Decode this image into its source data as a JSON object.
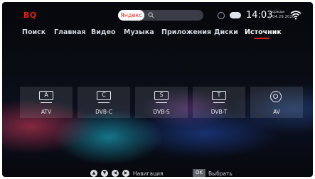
{
  "header": {
    "logo": "BQ",
    "search": {
      "brand": "Яндекс"
    },
    "time": "14:03",
    "date_day": "среда",
    "date_full": "04.29.2020"
  },
  "nav": {
    "items": [
      "Поиск",
      "Главная",
      "Видео",
      "Музыка",
      "Приложения",
      "Диски",
      "Источник"
    ],
    "active": "Источник",
    "accent": "#e0201c"
  },
  "sources": [
    {
      "icon_letter": "A",
      "label": "ATV",
      "icon": "tv-icon"
    },
    {
      "icon_letter": "C",
      "label": "DVB-C",
      "icon": "tv-icon"
    },
    {
      "icon_letter": "S",
      "label": "DVB-S",
      "icon": "tv-icon"
    },
    {
      "icon_letter": "T",
      "label": "DVB-T",
      "icon": "tv-icon"
    },
    {
      "icon_letter": "",
      "label": "AV",
      "icon": "av-ring-icon"
    }
  ],
  "footer": {
    "nav_hint": "Навигация",
    "ok_label": "OK",
    "select_hint": "Выбрать"
  }
}
